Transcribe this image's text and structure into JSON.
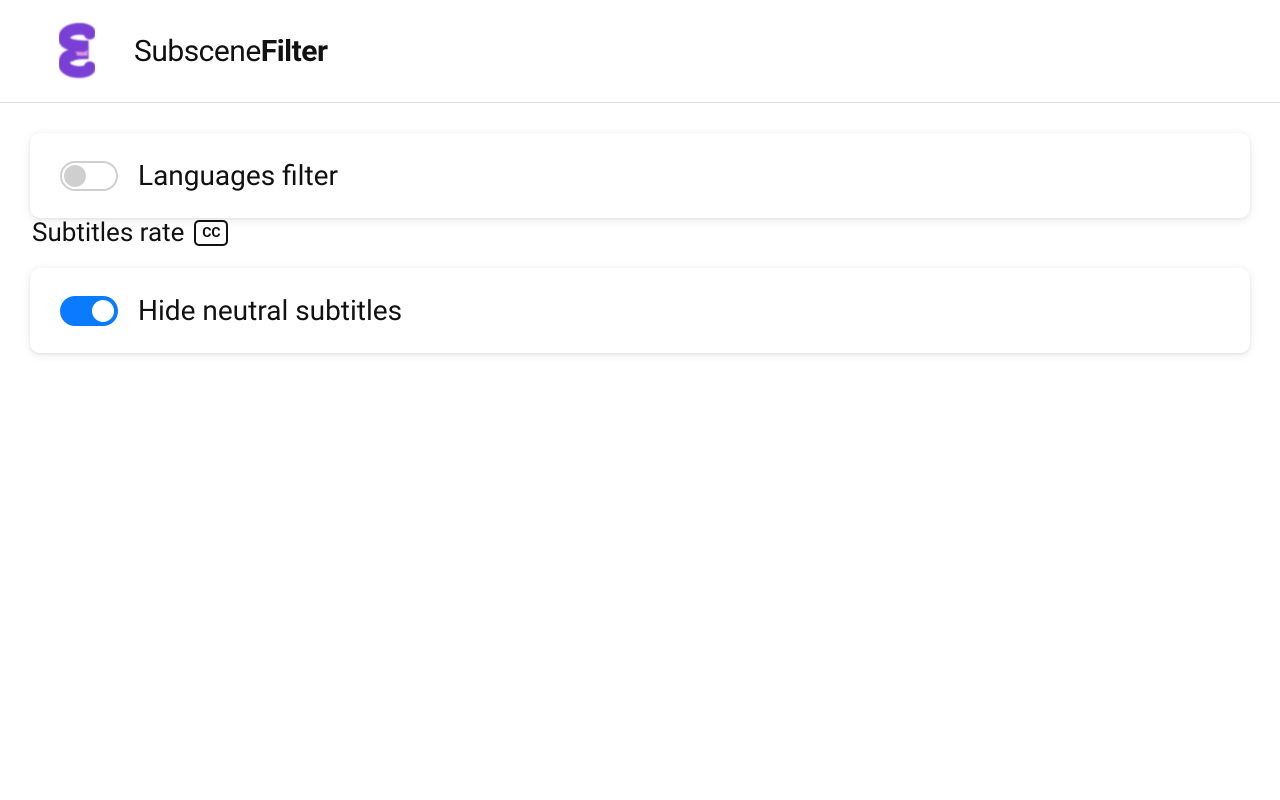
{
  "header": {
    "title_light": "Subscene",
    "title_bold": "Filter"
  },
  "cards": {
    "languages_filter": {
      "label": "Languages filter",
      "toggle_on": false
    },
    "hide_neutral": {
      "label": "Hide neutral subtitles",
      "toggle_on": true
    }
  },
  "section": {
    "subtitles_rate_label": "Subtitles rate",
    "cc_text": "CC"
  }
}
